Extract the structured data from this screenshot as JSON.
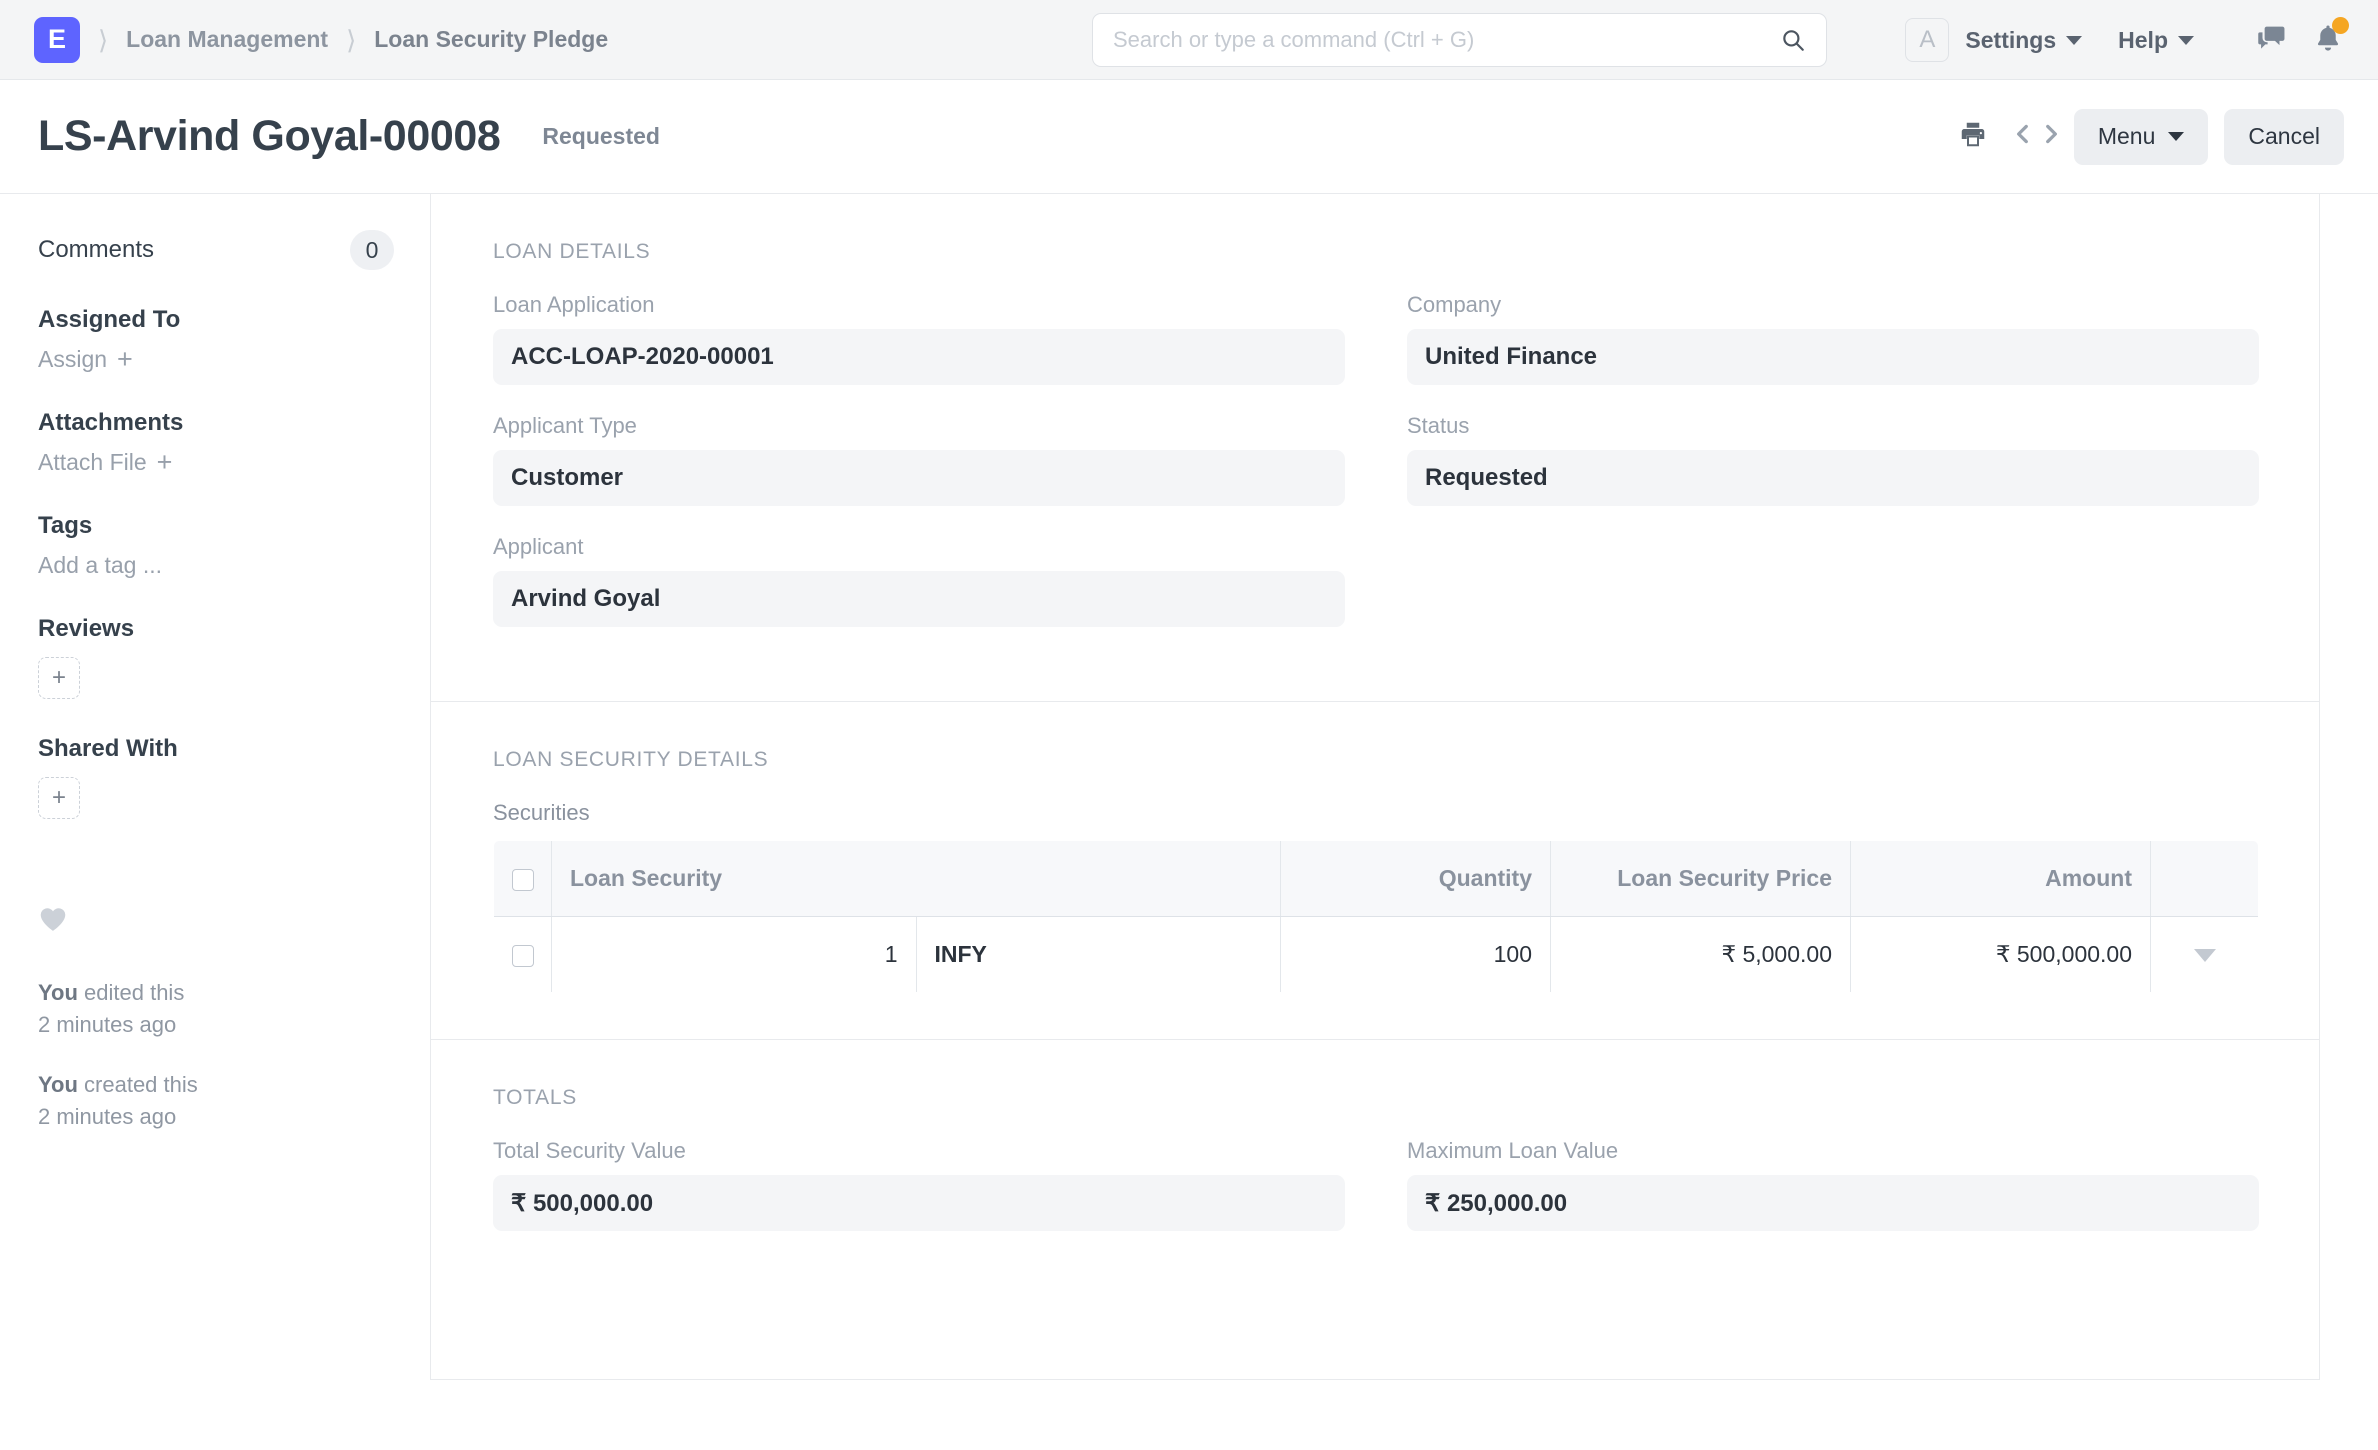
{
  "navbar": {
    "logo_letter": "E",
    "breadcrumbs": [
      {
        "label": "Loan Management"
      },
      {
        "label": "Loan Security Pledge"
      }
    ],
    "search": {
      "placeholder": "Search or type a command (Ctrl + G)",
      "value": ""
    },
    "avatar_letter": "A",
    "settings_label": "Settings",
    "help_label": "Help",
    "icons": [
      "search-icon",
      "chat-icon",
      "bell-icon"
    ],
    "notification_dot_color": "#f5a623",
    "brand_color": "#5e64ff"
  },
  "page": {
    "title": "LS-Arvind Goyal-00008",
    "status": "Requested",
    "actions": {
      "print_icon": "print-icon",
      "prev_icon": "chevron-left-icon",
      "next_icon": "chevron-right-icon",
      "menu_label": "Menu",
      "cancel_label": "Cancel"
    }
  },
  "sidebar": {
    "comments_label": "Comments",
    "comments_count": "0",
    "assigned_to_label": "Assigned To",
    "assign_label": "Assign",
    "attachments_label": "Attachments",
    "attach_file_label": "Attach File",
    "tags_label": "Tags",
    "add_tag_label": "Add a tag ...",
    "reviews_label": "Reviews",
    "shared_with_label": "Shared With",
    "add_symbol": "+",
    "audit": [
      {
        "actor": "You",
        "action": " edited this",
        "time": "2 minutes ago"
      },
      {
        "actor": "You",
        "action": " created this",
        "time": "2 minutes ago"
      }
    ]
  },
  "loan_details": {
    "section_title": "LOAN DETAILS",
    "fields": {
      "loan_application": {
        "label": "Loan Application",
        "value": "ACC-LOAP-2020-00001"
      },
      "company": {
        "label": "Company",
        "value": "United Finance"
      },
      "applicant_type": {
        "label": "Applicant Type",
        "value": "Customer"
      },
      "status": {
        "label": "Status",
        "value": "Requested"
      },
      "applicant": {
        "label": "Applicant",
        "value": "Arvind Goyal"
      }
    }
  },
  "loan_security_details": {
    "section_title": "LOAN SECURITY DETAILS",
    "grid_label": "Securities",
    "columns": [
      "Loan Security",
      "Quantity",
      "Loan Security Price",
      "Amount"
    ],
    "rows": [
      {
        "index": "1",
        "loan_security": "INFY",
        "quantity": "100",
        "loan_security_price": "₹ 5,000.00",
        "amount": "₹ 500,000.00"
      }
    ]
  },
  "totals": {
    "section_title": "TOTALS",
    "fields": {
      "total_security_value": {
        "label": "Total Security Value",
        "value": "₹ 500,000.00"
      },
      "maximum_loan_value": {
        "label": "Maximum Loan Value",
        "value": "₹ 250,000.00"
      }
    }
  }
}
